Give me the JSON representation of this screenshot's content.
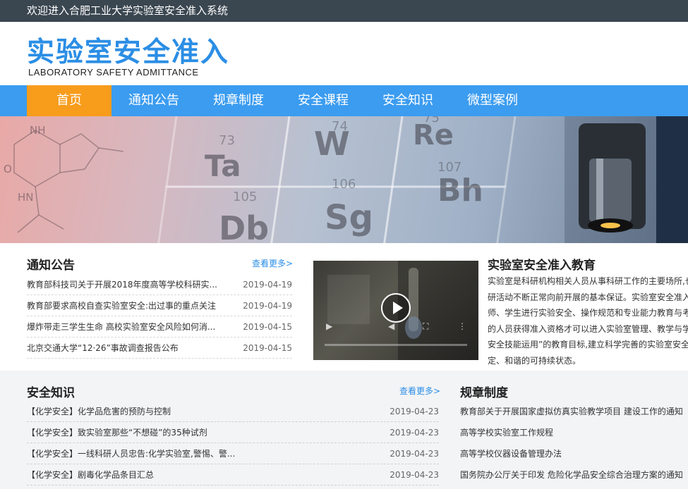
{
  "topbar": {
    "welcome": "欢迎进入合肥工业大学实验室安全准入系统"
  },
  "header": {
    "logo_cn": "实验室安全准入",
    "logo_en": "LABORATORY SAFETY ADMITTANCE"
  },
  "nav": {
    "items": [
      {
        "label": "首页",
        "active": true
      },
      {
        "label": "通知公告"
      },
      {
        "label": "规章制度"
      },
      {
        "label": "安全课程"
      },
      {
        "label": "安全知识"
      },
      {
        "label": "微型案例"
      }
    ]
  },
  "banner": {
    "elements": [
      "W",
      "Re",
      "Ta",
      "Sg",
      "Bh",
      "Db",
      "105",
      "106",
      "107",
      "74",
      "75",
      "73",
      "NH",
      "HN",
      "O"
    ]
  },
  "notices": {
    "title": "通知公告",
    "more": "查看更多>",
    "items": [
      {
        "title": "教育部科技司关于开展2018年度高等学校科研实...",
        "date": "2019-04-19"
      },
      {
        "title": "教育部要求高校自查实验室安全:出过事的重点关注",
        "date": "2019-04-19"
      },
      {
        "title": "爆炸带走三学生生命 高校实验室安全风险如何消...",
        "date": "2019-04-15"
      },
      {
        "title": "北京交通大学“12·26”事故调查报告公布",
        "date": "2019-04-15"
      }
    ]
  },
  "education": {
    "title": "实验室安全准入教育",
    "lines": [
      "实验室是科研机构相关人员从事科研工作的主要场所,也",
      "研活动不断正常向前开展的基本保证。实验室安全准入",
      "师、学生进行实验安全、操作规范和专业能力教育与考",
      "的人员获得准入资格才可以进入实验室管理、教学与学",
      "安全技能运用”的教育目标,建立科学完善的实验室安全",
      "定、和谐的可持续状态。"
    ]
  },
  "knowledge": {
    "title": "安全知识",
    "more": "查看更多>",
    "items": [
      {
        "title": "【化学安全】化学品危害的预防与控制",
        "date": "2019-04-23"
      },
      {
        "title": "【化学安全】致实验室那些“不想碰”的35种试剂",
        "date": "2019-04-23"
      },
      {
        "title": "【化学安全】一线科研人员忠告:化学实验室,警惕、警...",
        "date": "2019-04-23"
      },
      {
        "title": "【化学安全】剧毒化学品条目汇总",
        "date": "2019-04-23"
      }
    ]
  },
  "regulations": {
    "title": "规章制度",
    "items": [
      "教育部关于开展国家虚拟仿真实验教学项目 建设工作的通知",
      "高等学校实验室工作规程",
      "高等学校仪器设备管理办法",
      "国务院办公厅关于印发 危险化学品安全综合治理方案的通知"
    ]
  },
  "colors": {
    "accent": "#3b9cf0",
    "active": "#f89c1c",
    "topbar": "#3a4650",
    "logo": "#2b8ee5"
  }
}
